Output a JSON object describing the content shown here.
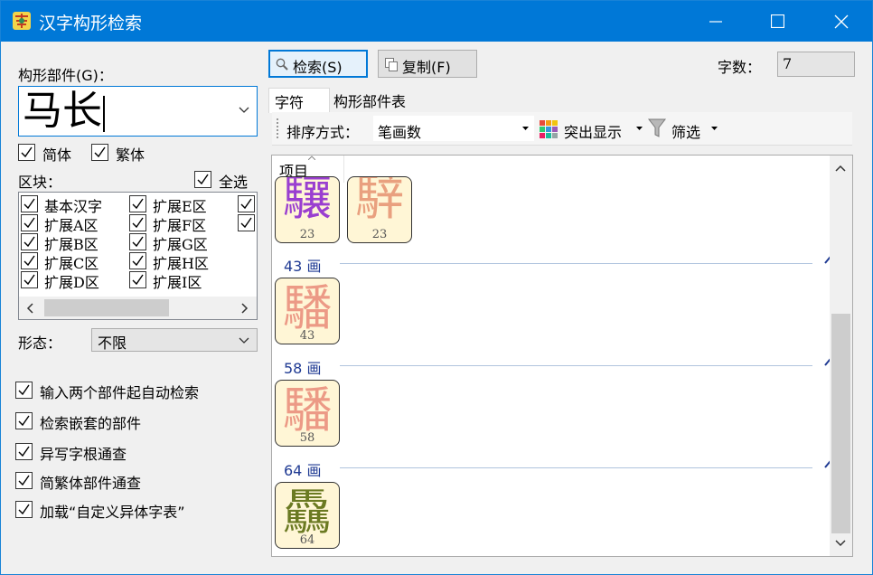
{
  "window": {
    "title": "汉字构形检索",
    "icon": "app-logo-icon",
    "controls": {
      "minimize": "minimize-icon",
      "maximize": "maximize-icon",
      "close": "close-icon"
    }
  },
  "left": {
    "component_label": "构形部件(G)：",
    "component_value": "马长",
    "simplified_label": "简体",
    "traditional_label": "繁体",
    "block_label": "区块：",
    "select_all_label": "全选",
    "blocks": [
      "基本汉字",
      "扩展A区",
      "扩展B区",
      "扩展C区",
      "扩展D区",
      "扩展E区",
      "扩展F区",
      "扩展G区",
      "扩展H区",
      "扩展I区"
    ],
    "form_label": "形态：",
    "form_value": "不限",
    "options": [
      "输入两个部件起自动检索",
      "检索嵌套的部件",
      "异写字根通查",
      "简繁体部件通查",
      "加载“自定义异体字表”"
    ]
  },
  "top": {
    "search_button": "检索(S)",
    "copy_button": "复制(F)",
    "count_label": "字数：",
    "count_value": "7"
  },
  "tabs": [
    "字符",
    "构形部件表"
  ],
  "toolbar": {
    "sort_label": "排序方式：",
    "sort_value": "笔画数",
    "highlight_label": "突出显示",
    "filter_label": "筛选"
  },
  "list": {
    "column_header": "项目",
    "tiles_top": [
      {
        "glyph": "驤",
        "count": "23",
        "color": "#9a3fd0"
      },
      {
        "glyph": "騂",
        "count": "23",
        "color": "#e9a07f"
      }
    ],
    "groups": [
      {
        "header": "43 画",
        "glyph": "䮳",
        "count": "43",
        "color": "#ec9a86"
      },
      {
        "header": "58 画",
        "glyph": "䮳",
        "count": "58",
        "color": "#ec9a86"
      },
      {
        "header": "64 画",
        "glyph": "驫",
        "count": "64",
        "color": "#6b7a22"
      }
    ]
  },
  "colors": {
    "accent": "#0078d7",
    "group_header": "#1f3a93",
    "tile_bg": "#fff6d6"
  }
}
